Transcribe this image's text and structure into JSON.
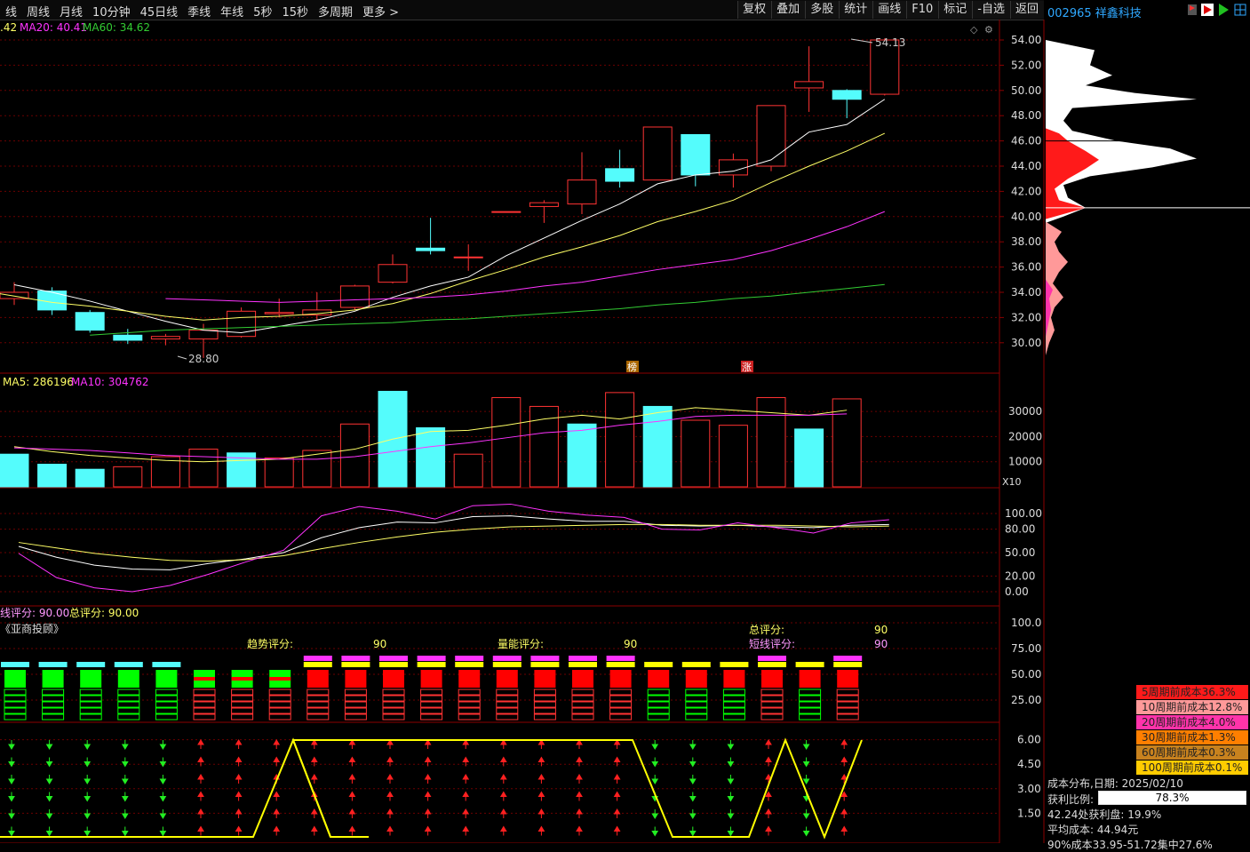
{
  "toolbar": {
    "periods": [
      "线",
      "周线",
      "月线",
      "10分钟",
      "45日线",
      "季线",
      "年线",
      "5秒",
      "15秒",
      "多周期",
      "更多 >"
    ],
    "tools": [
      "复权",
      "叠加",
      "多股",
      "统计",
      "画线",
      "F10",
      "标记",
      "-自选",
      "返回"
    ]
  },
  "stock": {
    "code_name": "002965 祥鑫科技"
  },
  "ma_legend": {
    "prefix": ".42",
    "ma20": "MA20: 40.41",
    "ma60": "MA60: 34.62",
    "colors": {
      "ma5": "#ffffff",
      "ma10": "#ffff66",
      "ma20": "#ff33ff",
      "ma60": "#33cc33"
    }
  },
  "price_axis": [
    "54.00",
    "52.00",
    "50.00",
    "48.00",
    "46.00",
    "44.00",
    "42.00",
    "40.00",
    "38.00",
    "36.00",
    "34.00",
    "32.00",
    "30.00"
  ],
  "price_annotations": {
    "high": "54.13",
    "low": "28.80",
    "mark1": "榜",
    "mark2": "涨"
  },
  "candles": [
    {
      "o": 33.5,
      "h": 34.8,
      "l": 33.0,
      "c": 34.0
    },
    {
      "o": 34.1,
      "h": 34.4,
      "l": 32.2,
      "c": 32.6
    },
    {
      "o": 32.4,
      "h": 32.6,
      "l": 30.8,
      "c": 31.0
    },
    {
      "o": 30.6,
      "h": 31.1,
      "l": 29.9,
      "c": 30.2
    },
    {
      "o": 30.3,
      "h": 30.7,
      "l": 29.8,
      "c": 30.5
    },
    {
      "o": 30.3,
      "h": 31.5,
      "l": 28.8,
      "c": 31.0
    },
    {
      "o": 30.5,
      "h": 32.8,
      "l": 30.4,
      "c": 32.5
    },
    {
      "o": 32.3,
      "h": 33.5,
      "l": 32.0,
      "c": 32.4
    },
    {
      "o": 32.2,
      "h": 34.0,
      "l": 31.8,
      "c": 32.6
    },
    {
      "o": 32.8,
      "h": 34.6,
      "l": 32.6,
      "c": 34.5
    },
    {
      "o": 34.8,
      "h": 37.0,
      "l": 34.7,
      "c": 36.2
    },
    {
      "o": 37.5,
      "h": 39.9,
      "l": 37.0,
      "c": 37.3
    },
    {
      "o": 36.8,
      "h": 37.8,
      "l": 35.7,
      "c": 36.8
    },
    {
      "o": 40.4,
      "h": 40.4,
      "l": 40.4,
      "c": 40.4
    },
    {
      "o": 40.8,
      "h": 41.3,
      "l": 39.5,
      "c": 41.1
    },
    {
      "o": 41.0,
      "h": 45.1,
      "l": 40.2,
      "c": 42.9
    },
    {
      "o": 43.8,
      "h": 45.3,
      "l": 42.3,
      "c": 42.8
    },
    {
      "o": 42.9,
      "h": 47.1,
      "l": 42.9,
      "c": 47.1
    },
    {
      "o": 46.5,
      "h": 46.5,
      "l": 42.4,
      "c": 43.3
    },
    {
      "o": 43.3,
      "h": 45.0,
      "l": 42.3,
      "c": 44.5
    },
    {
      "o": 44.0,
      "h": 48.8,
      "l": 43.6,
      "c": 48.8
    },
    {
      "o": 50.2,
      "h": 53.5,
      "l": 48.3,
      "c": 50.7
    },
    {
      "o": 50.0,
      "h": 50.1,
      "l": 47.8,
      "c": 49.3
    },
    {
      "o": 49.7,
      "h": 54.13,
      "l": 49.6,
      "c": 54.0
    }
  ],
  "ma_lines": {
    "ma5": [
      34.6,
      34.0,
      33.3,
      32.5,
      31.7,
      31.0,
      30.8,
      31.3,
      31.8,
      32.5,
      33.6,
      34.5,
      35.2,
      36.9,
      38.3,
      39.7,
      41.0,
      42.6,
      43.3,
      43.6,
      44.5,
      46.7,
      47.3,
      49.3
    ],
    "ma10": [
      34.8,
      34.2,
      33.7,
      33.2,
      32.9,
      32.5,
      32.1,
      31.8,
      32.0,
      32.1,
      32.3,
      32.6,
      33.1,
      33.9,
      34.9,
      35.8,
      36.8,
      37.6,
      38.5,
      39.6,
      40.4,
      41.3,
      42.7,
      44.0,
      45.2,
      46.6
    ],
    "ma20": [
      33.5,
      33.4,
      33.3,
      33.2,
      33.3,
      33.4,
      33.5,
      33.6,
      33.8,
      34.1,
      34.5,
      34.8,
      35.3,
      35.8,
      36.2,
      36.6,
      37.3,
      38.2,
      39.2,
      40.4
    ],
    "ma60": [
      30.6,
      30.8,
      31.0,
      31.1,
      31.2,
      31.3,
      31.4,
      31.5,
      31.6,
      31.8,
      31.9,
      32.1,
      32.3,
      32.5,
      32.7,
      33.0,
      33.2,
      33.5,
      33.7,
      34.0,
      34.3,
      34.62
    ]
  },
  "volume": {
    "legend_ma5": "MA5: 286196",
    "legend_ma10": "MA10: 304762",
    "axis": [
      "30000",
      "20000",
      "10000"
    ],
    "unit": "X10",
    "bars": [
      13000,
      9000,
      7000,
      8000,
      12000,
      15000,
      13500,
      11500,
      14500,
      25000,
      38000,
      23500,
      13000,
      35500,
      32000,
      25000,
      37500,
      32000,
      26500,
      24500,
      35500,
      23000,
      35000
    ],
    "down": [
      true,
      true,
      true,
      false,
      false,
      false,
      true,
      false,
      false,
      false,
      true,
      true,
      false,
      false,
      false,
      true,
      false,
      true,
      false,
      false,
      false,
      true,
      false
    ]
  },
  "osc": {
    "axis": [
      "100.00",
      "80.00",
      "50.00",
      "20.00",
      "0.00"
    ]
  },
  "score": {
    "line_score": "线评分: 90.00",
    "total_score": "总评分: 90.00",
    "brand": "《亚商投顾》",
    "trend": "趋势评分:",
    "trend_val": "90",
    "energy": "量能评分:",
    "energy_val": "90",
    "total": "总评分:",
    "total_val": "90",
    "short": "短线评分:",
    "short_val": "90",
    "axis": [
      "100.0",
      "75.00",
      "50.00",
      "25.00"
    ]
  },
  "arrow_panel": {
    "axis": [
      "6.00",
      "4.50",
      "3.00",
      "1.50"
    ]
  },
  "chip_dist": {
    "legend": [
      {
        "label": "5周期前成本36.3%",
        "bg": "#ff1a1a",
        "fg": "#222"
      },
      {
        "label": "10周期前成本12.8%",
        "bg": "#ff9999",
        "fg": "#222"
      },
      {
        "label": "20周期前成本4.0%",
        "bg": "#ff33aa",
        "fg": "#222"
      },
      {
        "label": "30周期前成本1.3%",
        "bg": "#ff7f00",
        "fg": "#222"
      },
      {
        "label": "60周期前成本0.3%",
        "bg": "#c8821e",
        "fg": "#222"
      },
      {
        "label": "100周期前成本0.1%",
        "bg": "#ffcc00",
        "fg": "#222"
      }
    ],
    "date_line": "成本分布,日期: 2025/02/10",
    "profit_label": "获利比例:",
    "profit_value": "78.3%",
    "profit_ratio": 0.783,
    "profit_line": "42.24处获利盘: 19.9%",
    "avg_cost": "平均成本: 44.94元",
    "cost_90": "90%成本33.95-51.72集中27.6%"
  }
}
